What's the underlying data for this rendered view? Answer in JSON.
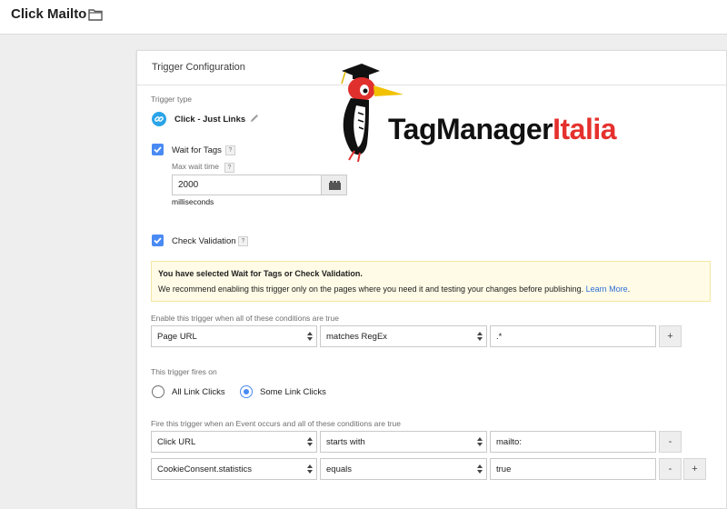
{
  "page": {
    "title": "Click Mailto"
  },
  "card": {
    "title": "Trigger Configuration",
    "trigger_type": {
      "label": "Trigger type",
      "name": "Click - Just Links"
    },
    "wait_for_tags": {
      "label": "Wait for Tags",
      "checked": true,
      "help": "?",
      "max_wait_label": "Max wait time",
      "max_wait_value": "2000",
      "unit": "milliseconds"
    },
    "check_validation": {
      "label": "Check Validation",
      "checked": true,
      "help": "?"
    },
    "notice": {
      "title": "You have selected Wait for Tags or Check Validation.",
      "body": "We recommend enabling this trigger only on the pages where you need it and testing your changes before publishing.",
      "link": "Learn More",
      "link_suffix": "."
    },
    "enable_conditions": {
      "label": "Enable this trigger when all of these conditions are true",
      "rows": [
        {
          "variable": "Page URL",
          "operator": "matches RegEx",
          "value": ".*"
        }
      ],
      "add": "+"
    },
    "fires_on": {
      "label": "This trigger fires on",
      "options": [
        {
          "label": "All Link Clicks",
          "selected": false
        },
        {
          "label": "Some Link Clicks",
          "selected": true
        }
      ]
    },
    "fire_conditions": {
      "label": "Fire this trigger when an Event occurs and all of these conditions are true",
      "rows": [
        {
          "variable": "Click URL",
          "operator": "starts with",
          "value": "mailto:"
        },
        {
          "variable": "CookieConsent.statistics",
          "operator": "equals",
          "value": "true"
        }
      ],
      "remove": "-",
      "add": "+"
    }
  },
  "watermark": {
    "part1": "TagManager",
    "part2": "Italia"
  },
  "colors": {
    "accent": "#4a8af4",
    "link": "#2e6fd8",
    "notice_bg": "#fffbe6",
    "brand_red": "#e5302d"
  },
  "icons": [
    "folder-icon",
    "link-icon",
    "pencil-icon",
    "check-icon",
    "variable-icon",
    "select-arrows-icon"
  ]
}
